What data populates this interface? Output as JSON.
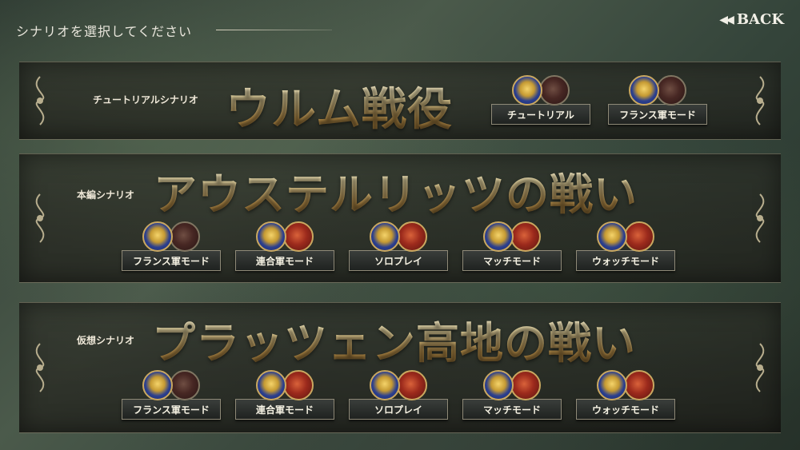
{
  "header": {
    "title": "シナリオを選択してください",
    "back_label": "BACK",
    "back_icon": "◀◀"
  },
  "scenarios": [
    {
      "tag": "チュートリアルシナリオ",
      "title": "ウルム戦役",
      "modes": [
        "チュートリアル",
        "フランス軍モード"
      ]
    },
    {
      "tag": "本編シナリオ",
      "title": "アウステルリッツの戦い",
      "modes": [
        "フランス軍モード",
        "連合軍モード",
        "ソロプレイ",
        "マッチモード",
        "ウォッチモード"
      ]
    },
    {
      "tag": "仮想シナリオ",
      "title": "プラッツェン高地の戦い",
      "modes": [
        "フランス軍モード",
        "連合軍モード",
        "ソロプレイ",
        "マッチモード",
        "ウォッチモード"
      ]
    }
  ],
  "colors": {
    "gold": "#e9d9a4",
    "label_bg": "#2b2e2c",
    "france_blue": "#2b3f8f",
    "allied_red": "#9c2a1c"
  }
}
